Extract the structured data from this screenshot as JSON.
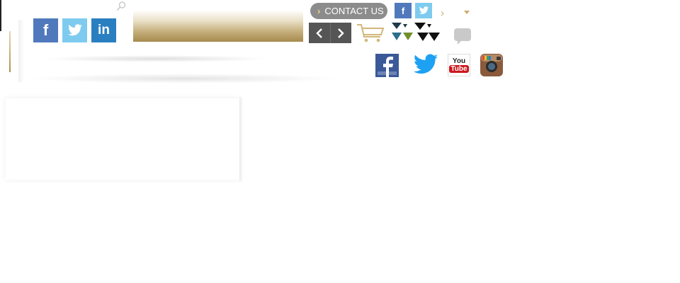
{
  "header": {
    "contact_label": "CONTACT US",
    "social_small": [
      "f",
      "twitter",
      "in"
    ],
    "social_mini": [
      "f",
      "twitter"
    ],
    "big_social": [
      {
        "icon": "facebook-icon",
        "color": "#3b5998"
      },
      {
        "icon": "twitter-icon",
        "color": "#1da1f2"
      },
      {
        "icon": "youtube-icon",
        "color": "#cc181e",
        "text_top": "You",
        "text_bottom": "Tube"
      },
      {
        "icon": "instagram-icon",
        "color": "#8a5a3b"
      }
    ]
  },
  "colors": {
    "gold_accent": "#c9ac6a",
    "facebook_blue": "#4f79bc",
    "twitter_blue": "#7ecbef",
    "linkedin_blue": "#2a7fc1",
    "nav_gray": "#555555"
  }
}
